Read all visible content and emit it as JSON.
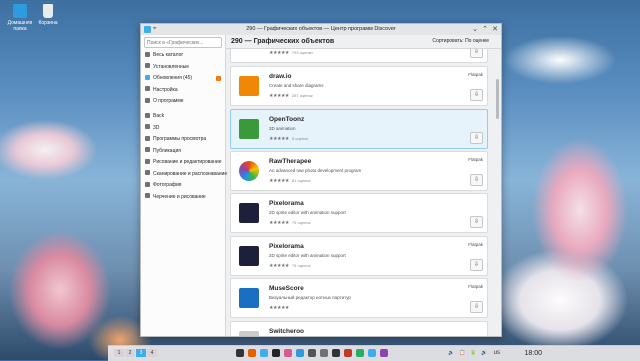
{
  "desktop": {
    "icons": [
      {
        "label": "Домашняя папка",
        "icon": "folder-home-icon",
        "color": "#2d9be0"
      },
      {
        "label": "Корзина",
        "icon": "trash-icon",
        "color": "#e9ecef"
      }
    ]
  },
  "window": {
    "title": "290 — Графических объектов — Центр программ Discover"
  },
  "sidebar": {
    "search_placeholder": "Поиск в «Графических...",
    "items": [
      {
        "label": "Весь каталог",
        "icon": "grid-icon",
        "color": "#6f7275"
      },
      {
        "label": "Установленные",
        "icon": "installed-icon",
        "color": "#6f7275"
      },
      {
        "label": "Обновления (45)",
        "icon": "updates-icon",
        "color": "#3daee9",
        "badge": "!"
      },
      {
        "label": "Настройка",
        "icon": "settings-icon",
        "color": "#6f7275"
      },
      {
        "label": "О программе",
        "icon": "info-icon",
        "color": "#6f7275"
      },
      {
        "label": "Back",
        "icon": "back-arrow-icon",
        "color": "#6f7275"
      },
      {
        "label": "3D",
        "icon": "3d-icon",
        "color": "#6f7275"
      },
      {
        "label": "Программы просмотра",
        "icon": "viewer-icon",
        "color": "#6f7275"
      },
      {
        "label": "Публикация",
        "icon": "publishing-icon",
        "color": "#6f7275"
      },
      {
        "label": "Рисование и редактирование",
        "icon": "paint-icon",
        "color": "#6f7275"
      },
      {
        "label": "Сканирование и распознавание",
        "icon": "scanner-icon",
        "color": "#6f7275"
      },
      {
        "label": "Фотография",
        "icon": "camera-icon",
        "color": "#6f7275"
      },
      {
        "label": "Черчение и рисование",
        "icon": "drawing-icon",
        "color": "#6f7275"
      }
    ]
  },
  "header": {
    "title": "290 — Графических объектов",
    "sort_label": "Сортировать: По оценке"
  },
  "apps": [
    {
      "name": "",
      "desc": "",
      "stars": "★★★★★",
      "ratings": "793 оценки",
      "source": "",
      "icon": "app-icon",
      "color": "#ffffff"
    },
    {
      "name": "draw.io",
      "desc": "Create and share diagrams",
      "stars": "★★★★★",
      "ratings": "287 оценок",
      "source": "Flatpak",
      "icon": "drawio-icon",
      "color": "#f08705"
    },
    {
      "name": "OpenToonz",
      "desc": "2D animation",
      "stars": "★★★★★",
      "ratings": "5 оценок",
      "source": "",
      "icon": "opentoonz-icon",
      "color": "#3a9a3a",
      "highlight": true
    },
    {
      "name": "RawTherapee",
      "desc": "An advanced raw photo development program",
      "stars": "★★★★★",
      "ratings": "81 оценка",
      "source": "Flatpak",
      "icon": "rawtherapee-icon",
      "color": "#e84a1f"
    },
    {
      "name": "Pixelorama",
      "desc": "2D sprite editor with animation support",
      "stars": "★★★★★",
      "ratings": "75 оценок",
      "source": "",
      "icon": "pixelorama-icon",
      "color": "#1e1f3b"
    },
    {
      "name": "Pixelorama",
      "desc": "2D sprite editor with animation support",
      "stars": "★★★★★",
      "ratings": "75 оценок",
      "source": "Flatpak",
      "icon": "pixelorama-icon",
      "color": "#1e1f3b"
    },
    {
      "name": "MuseScore",
      "desc": "Визуальный редактор нотных партитур",
      "stars": "★★★★★",
      "ratings": "",
      "source": "Flatpak",
      "icon": "musescore-icon",
      "color": "#1a6fc2"
    },
    {
      "name": "Switcheroo",
      "desc": "",
      "stars": "",
      "ratings": "",
      "source": "",
      "icon": "app-icon",
      "color": "#cccccc"
    }
  ],
  "install_glyph": "⇩",
  "taskbar": {
    "pager": [
      "1",
      "2",
      "3",
      "4"
    ],
    "active_page": "3",
    "apps": [
      {
        "icon": "overview-icon",
        "color": "#333333"
      },
      {
        "icon": "firefox-icon",
        "color": "#e66000"
      },
      {
        "icon": "dolphin-icon",
        "color": "#3daee9"
      },
      {
        "icon": "konsole-icon",
        "color": "#232629"
      },
      {
        "icon": "photos-icon",
        "color": "#d35b8f"
      },
      {
        "icon": "store-icon",
        "color": "#2d9be0"
      },
      {
        "icon": "settings-icon",
        "color": "#555555"
      },
      {
        "icon": "shield-icon",
        "color": "#6f7275"
      },
      {
        "icon": "terminal-icon",
        "color": "#2e3436"
      },
      {
        "icon": "music-icon",
        "color": "#c0392b"
      },
      {
        "icon": "chat-icon",
        "color": "#27ae60"
      },
      {
        "icon": "discover-icon",
        "color": "#3daee9"
      },
      {
        "icon": "photo-icon",
        "color": "#8e44ad"
      }
    ],
    "tray": [
      "🔉",
      "📋",
      "🔋",
      "🔊"
    ],
    "lang": "us",
    "time": "18:00"
  }
}
